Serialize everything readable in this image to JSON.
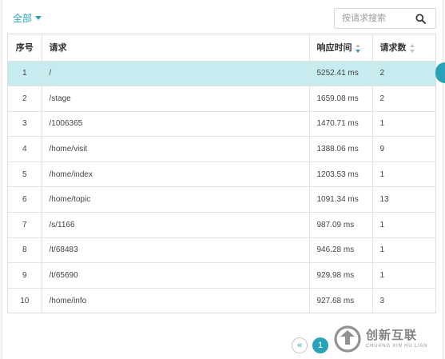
{
  "filter": {
    "label": "全部"
  },
  "search": {
    "placeholder": "按请求搜索"
  },
  "table": {
    "headers": {
      "index": "序号",
      "request": "请求",
      "response_time": "响应时间",
      "request_count": "请求数"
    },
    "rows": [
      {
        "index": "1",
        "request": "/",
        "response_time": "5252.41 ms",
        "request_count": "2"
      },
      {
        "index": "2",
        "request": "/stage",
        "response_time": "1659.08 ms",
        "request_count": "2"
      },
      {
        "index": "3",
        "request": "/1006365",
        "response_time": "1470.71 ms",
        "request_count": "1"
      },
      {
        "index": "4",
        "request": "/home/visit",
        "response_time": "1388.06 ms",
        "request_count": "9"
      },
      {
        "index": "5",
        "request": "/home/index",
        "response_time": "1203.53 ms",
        "request_count": "1"
      },
      {
        "index": "6",
        "request": "/home/topic",
        "response_time": "1091.34 ms",
        "request_count": "13"
      },
      {
        "index": "7",
        "request": "/s/1166",
        "response_time": "987.09 ms",
        "request_count": "1"
      },
      {
        "index": "8",
        "request": "/t/68483",
        "response_time": "946.28 ms",
        "request_count": "1"
      },
      {
        "index": "9",
        "request": "/t/65690",
        "response_time": "929.98 ms",
        "request_count": "1"
      },
      {
        "index": "10",
        "request": "/home/info",
        "response_time": "927.68 ms",
        "request_count": "3"
      }
    ],
    "selected_row": 0
  },
  "pagination": {
    "prev": "«",
    "current": "1"
  },
  "watermark": {
    "name": "创新互联",
    "pinyin": "CHUANG XIN HU LIAN"
  },
  "colors": {
    "accent": "#29a3b8",
    "selected_row_bg": "#c7ecef"
  },
  "icons": {
    "search": "search-icon",
    "filter_caret": "caret-down-icon",
    "sort": "sort-icon"
  }
}
